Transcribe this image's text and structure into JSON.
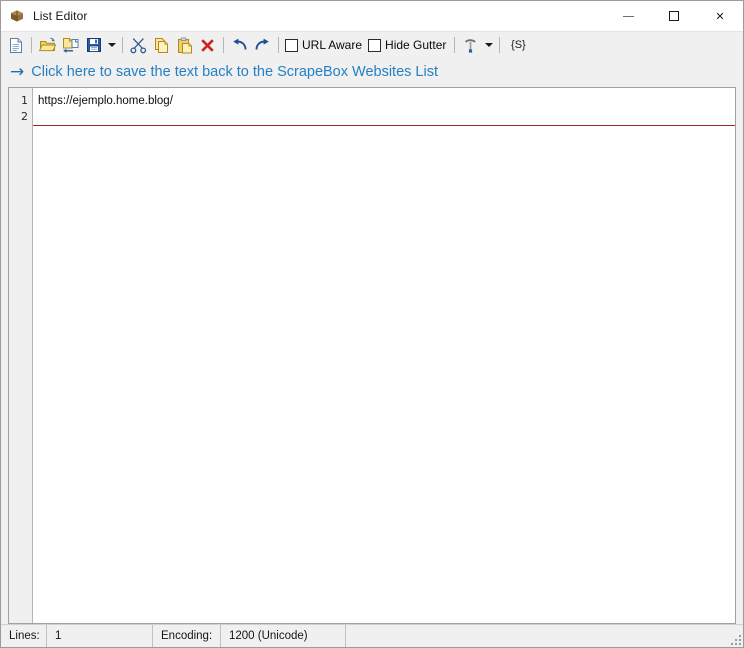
{
  "window": {
    "title": "List Editor",
    "app_icon": "package-box-icon",
    "caption": {
      "minimize": "minimize-icon",
      "maximize": "maximize-icon",
      "close": "close-icon",
      "close_glyph": "✕"
    }
  },
  "toolbar": {
    "buttons": [
      {
        "name": "new-file-button",
        "icon": "new-document-icon",
        "tooltip": "New"
      },
      {
        "name": "open-file-button",
        "icon": "open-folder-icon",
        "tooltip": "Open"
      },
      {
        "name": "import-file-button",
        "icon": "import-document-icon",
        "tooltip": "Import"
      },
      {
        "name": "save-file-button",
        "icon": "save-floppy-icon",
        "tooltip": "Save"
      },
      {
        "name": "cut-button",
        "icon": "scissors-icon",
        "tooltip": "Cut"
      },
      {
        "name": "copy-button",
        "icon": "copy-pages-icon",
        "tooltip": "Copy"
      },
      {
        "name": "paste-button",
        "icon": "paste-clipboard-icon",
        "tooltip": "Paste"
      },
      {
        "name": "delete-button",
        "icon": "red-x-delete-icon",
        "tooltip": "Delete"
      },
      {
        "name": "undo-button",
        "icon": "undo-arrow-icon",
        "tooltip": "Undo"
      },
      {
        "name": "redo-button",
        "icon": "redo-arrow-icon",
        "tooltip": "Redo"
      }
    ],
    "url_aware": {
      "label": "URL Aware",
      "checked": false
    },
    "hide_gutter": {
      "label": "Hide Gutter",
      "checked": false
    },
    "tools": {
      "icon": "hammer-tools-icon",
      "dropdown": "chevron-down-icon"
    },
    "script_button": {
      "label": "{S}"
    }
  },
  "save_link": {
    "arrow": "→",
    "text": "Click here to save the text back to the ScrapeBox Websites List",
    "color": "#2480c4"
  },
  "editor": {
    "gutter_numbers": [
      "1",
      "2"
    ],
    "lines": [
      "https://ejemplo.home.blog/"
    ],
    "active_line_color": "#9c2b2b",
    "background": "#ffffff"
  },
  "statusbar": {
    "lines_label": "Lines:",
    "lines_value": "1",
    "encoding_label": "Encoding:",
    "encoding_value": "1200  (Unicode)"
  }
}
